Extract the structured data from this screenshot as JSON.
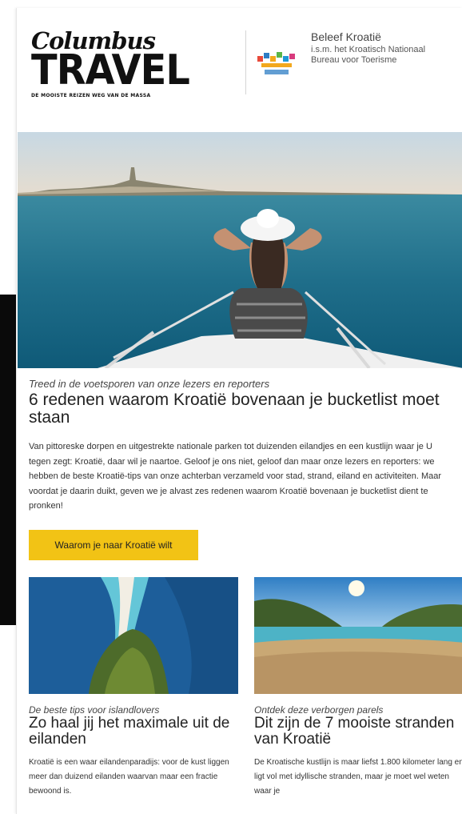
{
  "header": {
    "logo_script": "Columbus",
    "logo_main": "TRAVEL",
    "logo_tagline": "DE MOOISTE REIZEN WEG VAN DE MASSA",
    "partner_title": "Beleef Kroatië",
    "partner_sub_1": "i.s.m. het Kroatisch Nationaal",
    "partner_sub_2": "Bureau voor Toerisme"
  },
  "main_article": {
    "kicker": "Treed in de voetsporen van onze lezers en reporters",
    "headline": "6 redenen waarom Kroatië bovenaan je bucketlist moet staan",
    "body": "Van pittoreske dorpen en uitgestrekte nationale parken tot duizenden eilandjes en een kustlijn waar je U tegen zegt: Kroatië, daar wil je naartoe. Geloof je ons niet, geloof dan maar onze lezers en reporters: we hebben de beste Kroatië-tips van onze achterban verzameld voor stad, strand, eiland en activiteiten. Maar voordat je daarin duikt, geven we je alvast zes redenen waarom Kroatië bovenaan je bucketlist dient te pronken!",
    "cta_label": "Waarom je naar Kroatië wilt"
  },
  "tiles": [
    {
      "kicker": "De beste tips voor islandlovers",
      "title": "Zo haal jij het maximale uit de eilanden",
      "body": "Kroatië is een waar eilandenparadijs: voor de kust liggen meer dan duizend eilanden waarvan maar een fractie bewoond is."
    },
    {
      "kicker": "Ontdek deze verborgen parels",
      "title": "Dit zijn de 7 mooiste stranden van Kroatië",
      "body": "De Kroatische kustlijn is maar liefst 1.800 kilometer lang en ligt vol met idyllische stranden, maar je moet wel weten waar je"
    }
  ],
  "colors": {
    "cta": "#f2c315",
    "sea": "#2d7891",
    "sky": "#c9dbe6"
  }
}
